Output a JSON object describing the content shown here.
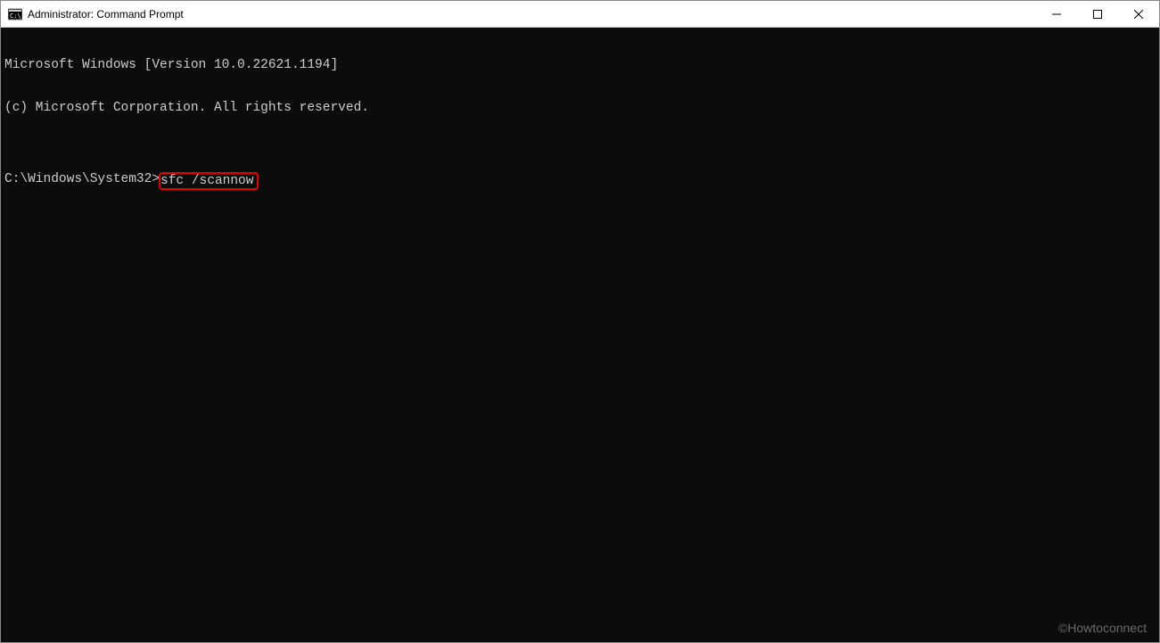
{
  "window": {
    "title": "Administrator: Command Prompt"
  },
  "terminal": {
    "line1": "Microsoft Windows [Version 10.0.22621.1194]",
    "line2": "(c) Microsoft Corporation. All rights reserved.",
    "blank": "",
    "prompt": "C:\\Windows\\System32>",
    "command": "sfc /scannow"
  },
  "watermark": "©Howtoconnect"
}
